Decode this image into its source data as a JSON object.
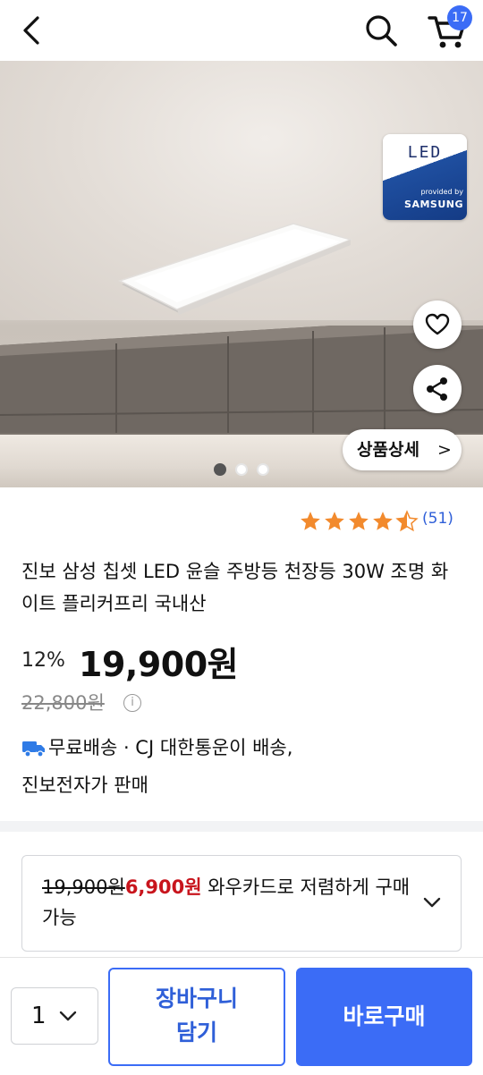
{
  "header": {
    "back_icon": "chevron-left-icon",
    "search_icon": "search-icon",
    "cart_icon": "cart-icon",
    "cart_count": "17"
  },
  "hero": {
    "badge": {
      "led_text": "LED",
      "provided_by": "provided by",
      "brand": "SAMSUNG"
    },
    "detail_label": "상품상세",
    "detail_chevron": ">",
    "carousel": {
      "total": 3,
      "active": 1
    }
  },
  "rating": {
    "stars": 4.5,
    "max": 5,
    "count_text": "(51)",
    "star_color": "#f28a2d"
  },
  "product": {
    "title": "진보 삼성 칩셋 LED 윤슬 주방등 천장등 30W 조명 화이트 플리커프리 국내산",
    "discount": "12%",
    "price": "19,900원",
    "original_price": "22,800원",
    "info_symbol": "i"
  },
  "shipping": {
    "text": "무료배송 · CJ 대한통운이 배송,",
    "seller": "진보전자가 판매"
  },
  "wow": {
    "original": "19,900원",
    "wow_price": "6,900원",
    "text": " 와우카드로 저렴하게 구매 가능"
  },
  "bottom": {
    "quantity": "1",
    "cart_button_line1": "장바구니",
    "cart_button_line2": "담기",
    "buy_button": "바로구매"
  },
  "colors": {
    "accent": "#3b6cf6",
    "price_red": "#c8151d",
    "link_blue": "#2f5fd8"
  }
}
